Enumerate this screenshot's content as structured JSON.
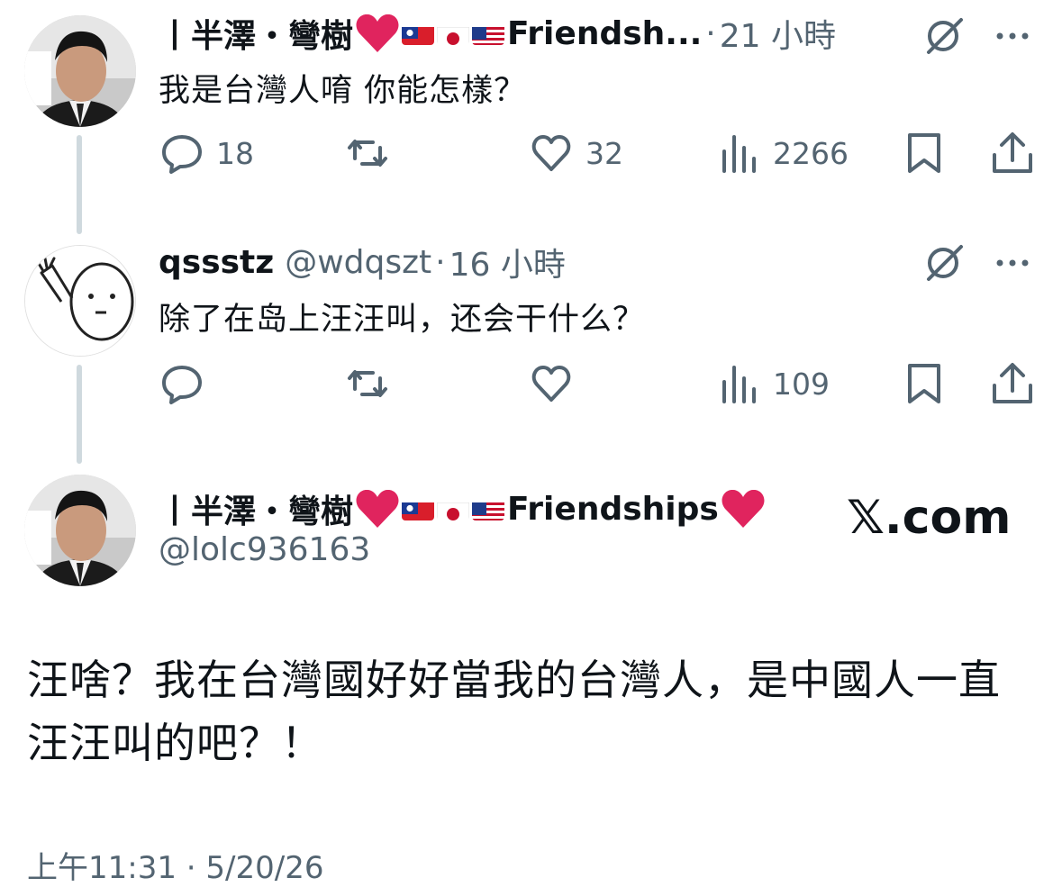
{
  "thread": [
    {
      "author_name": "丨半澤・彎樹",
      "author_suffix": "Friendsh...",
      "dot": "·",
      "time": "21 小時",
      "text": "我是台灣人唷 你能怎樣？",
      "stats": {
        "replies": "18",
        "reposts": "",
        "likes": "32",
        "views": "2266"
      }
    },
    {
      "author_name": "qssstz",
      "handle": "@wdqszt",
      "dot": "·",
      "time": "16 小時",
      "text": "除了在岛上汪汪叫，还会干什么？",
      "stats": {
        "replies": "",
        "reposts": "",
        "likes": "",
        "views": "109"
      }
    }
  ],
  "main_post": {
    "author_name": "丨半澤・彎樹",
    "author_suffix": "Friendships",
    "handle": "@lolc936163",
    "watermark": "𝕏.com",
    "text_line1": "汪啥？我在台灣國好好當我的台灣人，是中國人一直",
    "text_line2": "汪汪叫的吧？！",
    "timestamp": "上午11:31 · 5/20/26"
  },
  "icons": {
    "reply": "reply-icon",
    "repost": "repost-icon",
    "like": "heart-icon",
    "views": "views-icon",
    "bookmark": "bookmark-icon",
    "share": "share-icon",
    "more": "more-icon",
    "grok": "grok-icon"
  },
  "colors": {
    "text": "#0f1419",
    "muted": "#536471",
    "thread_line": "#cfd9de",
    "heart": "#e0245e"
  }
}
